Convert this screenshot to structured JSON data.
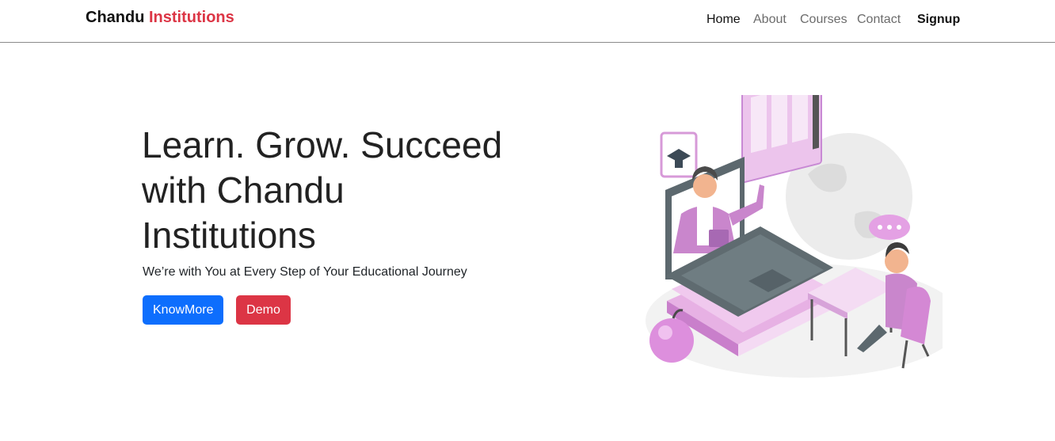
{
  "brand": {
    "first": "Chandu",
    "second": "Institutions",
    "accent_color": "#dc3545"
  },
  "nav": {
    "items": [
      {
        "label": "Home",
        "active": true
      },
      {
        "label": "About",
        "active": false
      },
      {
        "label": "Courses",
        "active": false
      },
      {
        "label": "Contact",
        "active": false
      }
    ],
    "signup_label": "Signup"
  },
  "hero": {
    "title": "Learn. Grow. Succeed with Chandu Institutions",
    "subtitle": "We’re with You at Every Step of Your Educational Journey",
    "primary_button": {
      "label": "KnowMore",
      "color": "#0d6efd"
    },
    "secondary_button": {
      "label": "Demo",
      "color": "#dc3545"
    }
  },
  "illustration": {
    "icon": "online-learning-illustration"
  }
}
